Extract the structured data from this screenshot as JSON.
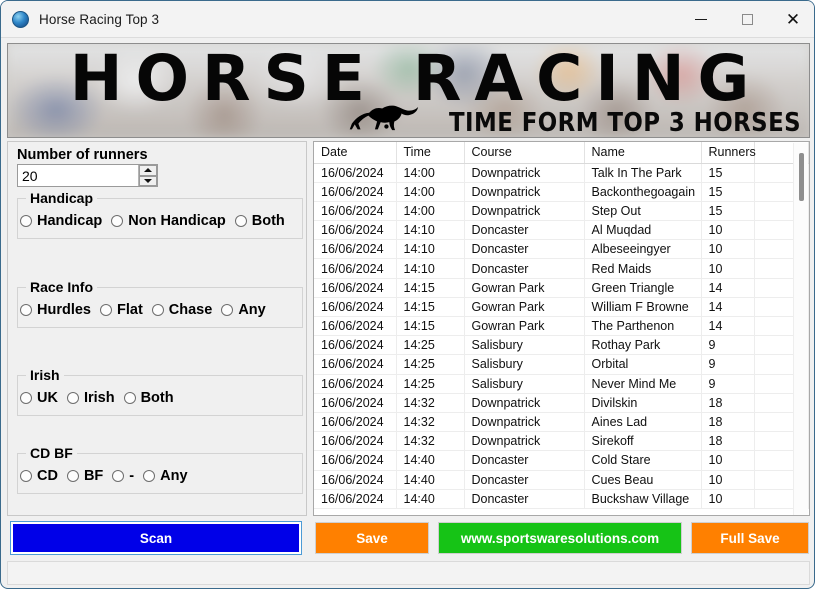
{
  "window": {
    "title": "Horse Racing Top 3",
    "app_icon": "globe-icon",
    "minimize_label": "",
    "maximize_label": "",
    "close_label": "✕"
  },
  "banner": {
    "title": "HORSE RACING",
    "subtitle": "TIME FORM TOP 3 HORSES",
    "horse_icon": "running-horse-icon"
  },
  "left_panel": {
    "runners": {
      "label": "Number of runners",
      "value": "20",
      "spin_up": "spinner-up-icon",
      "spin_down": "spinner-down-icon"
    },
    "handicap": {
      "legend": "Handicap",
      "options": [
        {
          "label": "Handicap",
          "selected": false
        },
        {
          "label": "Non Handicap",
          "selected": false
        },
        {
          "label": "Both",
          "selected": false
        }
      ]
    },
    "race_info": {
      "legend": "Race Info",
      "options": [
        {
          "label": "Hurdles",
          "selected": false
        },
        {
          "label": "Flat",
          "selected": false
        },
        {
          "label": "Chase",
          "selected": false
        },
        {
          "label": "Any",
          "selected": false
        }
      ]
    },
    "irish": {
      "legend": "Irish",
      "options": [
        {
          "label": "UK",
          "selected": false
        },
        {
          "label": "Irish",
          "selected": false
        },
        {
          "label": "Both",
          "selected": false
        }
      ]
    },
    "cd_bf": {
      "legend": "CD BF",
      "options": [
        {
          "label": "CD",
          "selected": false
        },
        {
          "label": "BF",
          "selected": false
        },
        {
          "label": "-",
          "selected": false
        },
        {
          "label": "Any",
          "selected": false
        }
      ]
    }
  },
  "grid": {
    "columns": [
      "Date",
      "Time",
      "Course",
      "Name",
      "Runners",
      ""
    ],
    "rows": [
      [
        "16/06/2024",
        "14:00",
        "Downpatrick",
        "Talk In The Park",
        "15",
        ""
      ],
      [
        "16/06/2024",
        "14:00",
        "Downpatrick",
        "Backonthegoagain",
        "15",
        ""
      ],
      [
        "16/06/2024",
        "14:00",
        "Downpatrick",
        "Step Out",
        "15",
        ""
      ],
      [
        "16/06/2024",
        "14:10",
        "Doncaster",
        "Al Muqdad",
        "10",
        ""
      ],
      [
        "16/06/2024",
        "14:10",
        "Doncaster",
        "Albeseeingyer",
        "10",
        ""
      ],
      [
        "16/06/2024",
        "14:10",
        "Doncaster",
        "Red Maids",
        "10",
        ""
      ],
      [
        "16/06/2024",
        "14:15",
        "Gowran Park",
        "Green Triangle",
        "14",
        ""
      ],
      [
        "16/06/2024",
        "14:15",
        "Gowran Park",
        "William F Browne",
        "14",
        ""
      ],
      [
        "16/06/2024",
        "14:15",
        "Gowran Park",
        "The Parthenon",
        "14",
        ""
      ],
      [
        "16/06/2024",
        "14:25",
        "Salisbury",
        "Rothay Park",
        "9",
        ""
      ],
      [
        "16/06/2024",
        "14:25",
        "Salisbury",
        "Orbital",
        "9",
        ""
      ],
      [
        "16/06/2024",
        "14:25",
        "Salisbury",
        "Never Mind Me",
        "9",
        ""
      ],
      [
        "16/06/2024",
        "14:32",
        "Downpatrick",
        "Divilskin",
        "18",
        ""
      ],
      [
        "16/06/2024",
        "14:32",
        "Downpatrick",
        "Aines Lad",
        "18",
        ""
      ],
      [
        "16/06/2024",
        "14:32",
        "Downpatrick",
        "Sirekoff",
        "18",
        ""
      ],
      [
        "16/06/2024",
        "14:40",
        "Doncaster",
        "Cold Stare",
        "10",
        ""
      ],
      [
        "16/06/2024",
        "14:40",
        "Doncaster",
        "Cues Beau",
        "10",
        ""
      ],
      [
        "16/06/2024",
        "14:40",
        "Doncaster",
        "Buckshaw Village",
        "10",
        ""
      ]
    ]
  },
  "buttons": {
    "scan": "Scan",
    "save": "Save",
    "website": "www.sportswaresolutions.com",
    "full_save": "Full Save"
  },
  "colors": {
    "scan": "#0000e8",
    "save": "#ff8000",
    "website": "#16c316",
    "full_save": "#ff8000"
  },
  "statusbar": {
    "text": ""
  }
}
